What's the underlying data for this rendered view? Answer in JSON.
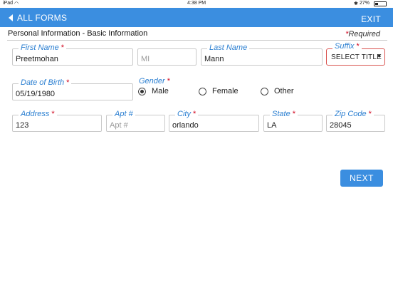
{
  "status_bar": {
    "carrier": "iPad",
    "time": "4:38 PM",
    "battery": "27%"
  },
  "nav": {
    "back_label": "ALL FORMS",
    "exit_label": "EXIT"
  },
  "section": {
    "title": "Personal Information - Basic Information",
    "required_star": "*",
    "required_text": "Required"
  },
  "fields": {
    "first_name": {
      "label": "First Name",
      "required": "*",
      "value": "Preetmohan"
    },
    "mi": {
      "placeholder": "MI",
      "value": ""
    },
    "last_name": {
      "label": "Last Name",
      "value": "Mann"
    },
    "suffix": {
      "label": "Suffix",
      "required": "*",
      "selected": "SELECT TITLE"
    },
    "dob": {
      "label": "Date of Birth",
      "required": "*",
      "value": "05/19/1980"
    },
    "gender": {
      "label": "Gender",
      "required": "*",
      "options": [
        "Male",
        "Female",
        "Other"
      ],
      "selected": "Male"
    },
    "address": {
      "label": "Address",
      "required": "*",
      "value": "123"
    },
    "apt": {
      "label": "Apt #",
      "placeholder": "Apt #",
      "value": ""
    },
    "city": {
      "label": "City",
      "required": "*",
      "value": "orlando"
    },
    "state": {
      "label": "State",
      "required": "*",
      "value": "LA"
    },
    "zip": {
      "label": "Zip Code",
      "required": "*",
      "value": "28045"
    }
  },
  "actions": {
    "next_label": "NEXT"
  },
  "colors": {
    "accent": "#3b8ee0",
    "label_blue": "#2b7fd1",
    "required_red": "#d0021b"
  }
}
